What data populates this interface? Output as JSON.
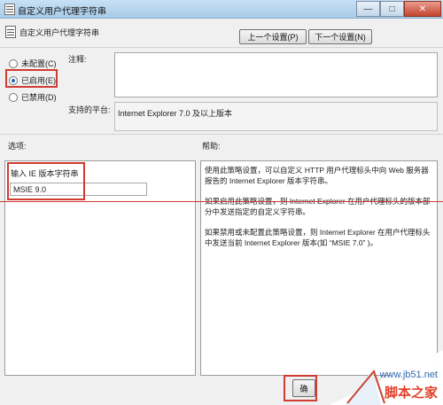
{
  "window": {
    "title": "自定义用户代理字符串",
    "minimize": "—",
    "maximize": "□",
    "close": "✕"
  },
  "header": {
    "setting_name": "自定义用户代理字符串",
    "prev_label": "上一个设置(P)",
    "next_label": "下一个设置(N)"
  },
  "state": {
    "not_configured": "未配置(C)",
    "enabled": "已启用(E)",
    "disabled": "已禁用(D)",
    "selected": "enabled"
  },
  "comment_label": "注释:",
  "platform": {
    "label": "支持的平台:",
    "value": "Internet Explorer 7.0 及以上版本"
  },
  "options": {
    "label": "选项:",
    "field_label": "输入 IE 版本字符串",
    "field_value": "MSIE 9.0"
  },
  "help": {
    "label": "帮助:",
    "paragraphs": [
      "使用此策略设置，可以自定义 HTTP 用户代理标头中向 Web 服务器报告的 Internet Explorer 版本字符串。",
      "如果启用此策略设置，则 Internet Explorer 在用户代理标头的版本部分中发送指定的自定义字符串。",
      "如果禁用或未配置此策略设置，则 Internet Explorer 在用户代理标头中发送当前 Internet Explorer 版本(如 “MSIE 7.0” )。"
    ]
  },
  "footer": {
    "ok_label": "确"
  },
  "watermark": {
    "site": "www.jb51.net",
    "name": "脚本之家"
  }
}
